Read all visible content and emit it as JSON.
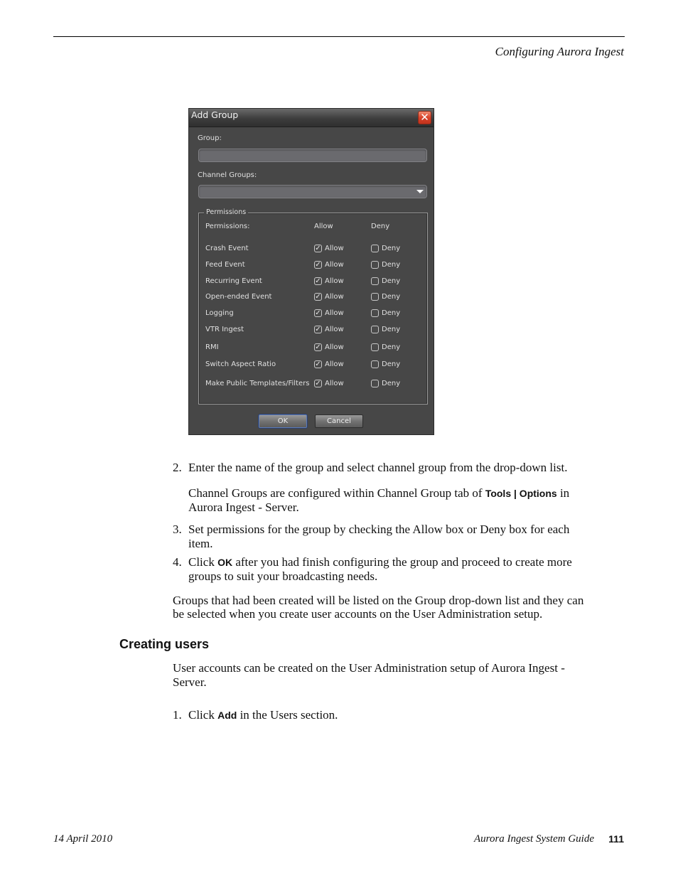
{
  "header": {
    "running_head": "Configuring Aurora Ingest"
  },
  "dialog": {
    "title": "Add Group",
    "close_icon": "close-icon",
    "group_label": "Group:",
    "group_value": "",
    "channel_groups_label": "Channel Groups:",
    "channel_groups_value": "",
    "permissions_legend": "Permissions",
    "col_permissions": "Permissions:",
    "col_allow": "Allow",
    "col_deny": "Deny",
    "permissions": [
      {
        "name": "Crash Event",
        "allow_label": "Allow",
        "deny_label": "Deny",
        "allow": true,
        "deny": false
      },
      {
        "name": "Feed Event",
        "allow_label": "Allow",
        "deny_label": "Deny",
        "allow": true,
        "deny": false
      },
      {
        "name": "Recurring Event",
        "allow_label": "Allow",
        "deny_label": "Deny",
        "allow": true,
        "deny": false
      },
      {
        "name": "Open-ended Event",
        "allow_label": "Allow",
        "deny_label": "Deny",
        "allow": true,
        "deny": false
      },
      {
        "name": "Logging",
        "allow_label": "Allow",
        "deny_label": "Deny",
        "allow": true,
        "deny": false
      },
      {
        "name": "VTR Ingest",
        "allow_label": "Allow",
        "deny_label": "Deny",
        "allow": true,
        "deny": false
      },
      {
        "name": "RMI",
        "allow_label": "Allow",
        "deny_label": "Deny",
        "allow": true,
        "deny": false
      },
      {
        "name": "Switch Aspect Ratio",
        "allow_label": "Allow",
        "deny_label": "Deny",
        "allow": true,
        "deny": false
      },
      {
        "name": "Make Public Templates/Filters",
        "allow_label": "Allow",
        "deny_label": "Deny",
        "allow": true,
        "deny": false
      }
    ],
    "ok_label": "OK",
    "cancel_label": "Cancel"
  },
  "body": {
    "step2_num": "2.",
    "step2_text": "Enter the name of the group and select channel group from the drop-down list.",
    "note_pre": "Channel Groups are configured within Channel Group tab of ",
    "note_ui": "Tools | Options",
    "note_post": " in Aurora Ingest - Server.",
    "step3_num": "3.",
    "step3_text": "Set permissions for the group by checking the Allow box or Deny box for each item.",
    "step4_num": "4.",
    "step4_pre": "Click ",
    "step4_ui": "OK",
    "step4_post": " after you had finish configuring the group and proceed to create more groups to suit your broadcasting needs.",
    "groups_para": "Groups that had been created will be listed on the Group drop-down list and they can be selected when you create user accounts on the User Administration setup.",
    "heading": "Creating users",
    "users_para": "User accounts can be created on the User Administration setup of Aurora Ingest - Server.",
    "step1_num": "1.",
    "step1_pre": "Click ",
    "step1_ui": "Add",
    "step1_post": " in the Users section."
  },
  "footer": {
    "date": "14 April 2010",
    "guide_title": "Aurora Ingest System Guide",
    "page_number": "111"
  }
}
